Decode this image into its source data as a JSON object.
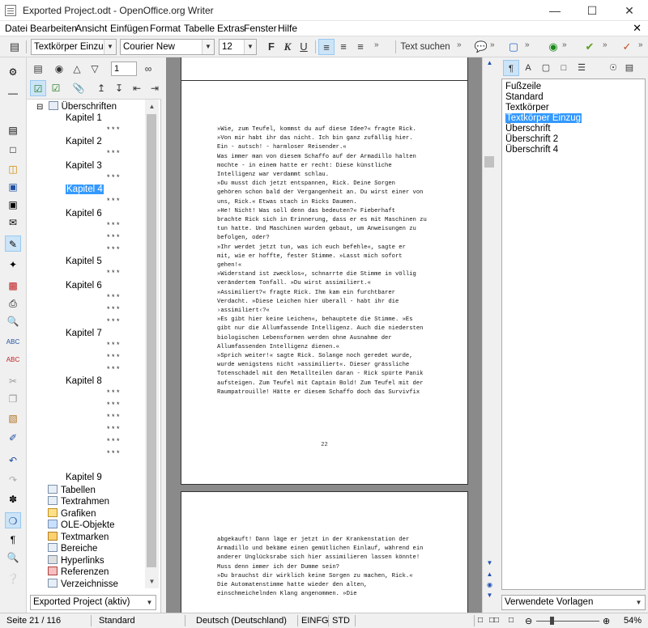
{
  "window": {
    "title": "Exported Project.odt - OpenOffice.org Writer"
  },
  "menu": [
    "Datei",
    "Bearbeiten",
    "Ansicht",
    "Einfügen",
    "Format",
    "Tabelle",
    "Extras",
    "Fenster",
    "Hilfe"
  ],
  "format_toolbar": {
    "paragraph_style": "Textkörper Einzug",
    "font_name": "Courier New",
    "font_size": "12",
    "bold": "F",
    "italic": "K",
    "underline": "U",
    "find_text": "Text suchen"
  },
  "navigator": {
    "heading_level": "1",
    "root": "Überschriften",
    "headings": [
      "Kapitel 1",
      "Kapitel 2",
      "Kapitel 3",
      "Kapitel 4",
      "Kapitel 6",
      "Kapitel 5",
      "Kapitel 6",
      "Kapitel 7",
      "Kapitel 8",
      "Kapitel 9"
    ],
    "stars": "* * *",
    "categories": [
      "Tabellen",
      "Textrahmen",
      "Grafiken",
      "OLE-Objekte",
      "Textmarken",
      "Bereiche",
      "Hyperlinks",
      "Referenzen",
      "Verzeichnisse"
    ],
    "document_select": "Exported Project (aktiv)"
  },
  "document": {
    "page_number": "22",
    "page22_lines": [
      "»Wie, zum Teufel, kommst du auf diese Idee?« fragte Rick.",
      "»Von mir habt ihr das nicht. Ich bin ganz zufällig hier.",
      "Ein - autsch! - harmloser Reisender.«",
      "Was immer man von diesem Schaffo auf der Armadillo halten",
      "mochte - in einem hatte er recht: Diese künstliche",
      "Intelligenz war verdammt schlau.",
      "»Du musst dich jetzt entspannen, Rick. Deine Sorgen",
      "gehören schon bald der Vergangenheit an. Du wirst einer von",
      "uns, Rick.« Etwas stach in Ricks Daumen.",
      "»He! Nicht! Was soll denn das bedeuten?« Fieberhaft",
      "brachte Rick sich in Erinnerung, dass er es mit Maschinen zu",
      "tun hatte. Und Maschinen wurden gebaut, um Anweisungen zu",
      "befolgen, oder?",
      "»Ihr werdet jetzt tun, was ich euch befehle«, sagte er",
      "mit, wie er hoffte, fester Stimme. »Lasst mich sofort",
      "gehen!«",
      "»Widerstand ist zwecklos«, schnarrte die Stimme in völlig",
      "verändertem Tonfall. »Du wirst assimiliert.«",
      "»Assimiliert?« fragte Rick. Ihm kam ein furchtbarer",
      "Verdacht. »Diese Leichen hier überall - habt ihr die",
      "›assimiliert‹?«",
      "»Es gibt hier keine Leichen«, behauptete die Stimme. »Es",
      "gibt nur die Allumfassende Intelligenz. Auch die niedersten",
      "biologischen Lebensformen werden ohne Ausnahme der",
      "Allumfassenden Intelligenz dienen.«",
      "»Sprich weiter!« sagte Rick. Solange noch geredet wurde,",
      "wurde wenigstens nicht »assimiliert«. Dieser grässliche",
      "Totenschädel mit den Metallteilen daran - Rick spürte Panik",
      "aufsteigen. Zum Teufel mit Captain Bold! Zum Teufel mit der",
      "Raumpatrouille! Hätte er diesem Schaffo doch das Survivfix"
    ],
    "page23_lines": [
      "abgekauft! Dann läge er jetzt in der Krankenstation der",
      "Armadillo und bekäme einen gemütlichen Einlauf, während ein",
      "anderer Unglücksrabe sich hier assimilieren lassen könnte!",
      "Muss denn immer ich der Dumme sein?",
      "»Du brauchst dir wirklich keine Sorgen zu machen, Rick.«",
      "Die Automatenstimme hatte wieder den alten,",
      "einschmeichelnden Klang angenommen. »Die"
    ]
  },
  "styles_panel": {
    "items": [
      "Fußzeile",
      "Standard",
      "Textkörper",
      "Textkörper Einzug",
      "Überschrift",
      "Überschrift 2",
      "Überschrift 4"
    ],
    "selected_index": 3,
    "filter": "Verwendete Vorlagen"
  },
  "status": {
    "page": "Seite 21 / 116",
    "style": "Standard",
    "language": "Deutsch (Deutschland)",
    "insert_mode": "EINFG",
    "selection_mode": "STD",
    "zoom": "54%"
  },
  "colors": {
    "selection": "#3399ff",
    "active_button": "#cce4f7",
    "doc_background": "#8a8a8a"
  }
}
